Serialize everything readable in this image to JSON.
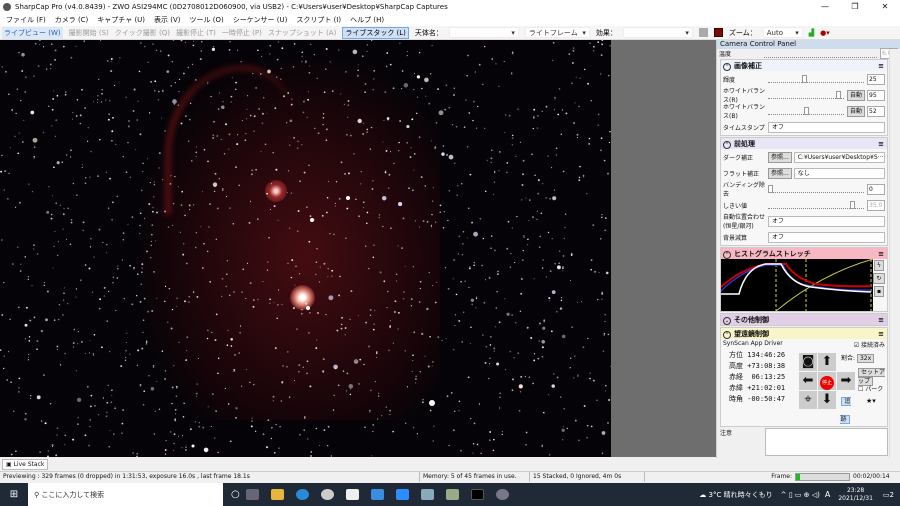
{
  "title": "SharpCap Pro (v4.0.8439) - ZWO ASI294MC (0D2708012D060900, via USB2) - C:¥Users¥user¥Desktop¥SharpCap Captures",
  "menu": [
    "ファイル (F)",
    "カメラ (C)",
    "キャプチャ (U)",
    "表示 (V)",
    "ツール (O)",
    "シーケンサー (U)",
    "スクリプト (I)",
    "ヘルプ (H)"
  ],
  "toolbar": {
    "live_view": "ライブビュー (W)",
    "start_capture": "撮影開始 (S)",
    "quick_capture": "クイック撮影 (Q)",
    "stop_capture": "撮影停止 (T)",
    "pause": "一時停止 (P)",
    "snapshot": "スナップショット (A)",
    "live_stack": "ライブスタック (L)",
    "target_label": "天体名：",
    "target_value": "",
    "frame_type": "ライトフレーム",
    "effect_label": "効果：",
    "effect_value": "",
    "zoom_label": "ズーム：",
    "zoom_value": "Auto"
  },
  "panel": {
    "title": "Camera Control Panel",
    "temp_label": "温度",
    "temp_value": "6.00",
    "image_section": {
      "title": "画像補正",
      "brightness_label": "輝度",
      "brightness": "25",
      "wb_r_label": "ホワイトバランス(R)",
      "wb_r": "95",
      "wb_b_label": "ホワイトバランス(B)",
      "wb_b": "52",
      "auto": "自動",
      "timestamp_label": "タイムスタンプ",
      "timestamp": "オフ"
    },
    "preprocess": {
      "title": "前処理",
      "dark_label": "ダーク補正",
      "browse": "参照...",
      "dark_value": "C:¥Users¥user¥Desktop¥S···",
      "flat_label": "フラット補正",
      "flat_value": "なし",
      "banding_label": "バンディング除去",
      "banding": "0",
      "threshold_label": "しきい値",
      "threshold": "35.0",
      "align_label": "自動位置合わせ (恒星/銀河)",
      "align": "オフ",
      "bg_label": "背景減算",
      "bg": "オフ"
    },
    "histogram": {
      "title": "ヒストグラムストレッチ"
    },
    "other": {
      "title": "その他制御"
    },
    "mount": {
      "title": "望遠鏡制御",
      "driver": "SynScan App Driver",
      "connected": "接続済み",
      "az_label": "方位",
      "az": "134:46:26",
      "alt_label": "高度",
      "alt": "+73:08:38",
      "ra_label": "赤経",
      "ra": "06:13:25",
      "dec_label": "赤緯",
      "dec": "+21:02:01",
      "ha_label": "時角",
      "ha": "-00:50:47",
      "rate_label": "割合:",
      "rate": "32x",
      "stop": "停止",
      "setup": "セットアップ",
      "park": "パーク",
      "track": "追跡",
      "notes_label": "注意"
    }
  },
  "tab": "Live Stack",
  "status": {
    "preview": "Previewing : 329 frames (0 dropped) in 1:31:53, exposure 16.0s , last frame 18.1s",
    "memory": "Memory: 5 of 45 frames in use.",
    "stack": "15 Stacked, 0 Ignored, 4m 0s",
    "frame_label": "Frame:",
    "time": "00:02/00:14"
  },
  "taskbar": {
    "search": "ここに入力して検索",
    "weather": "3°C 晴れ時々くもり",
    "ime": "A",
    "clock": "23:28",
    "date": "2021/12/31",
    "notif": "2"
  }
}
